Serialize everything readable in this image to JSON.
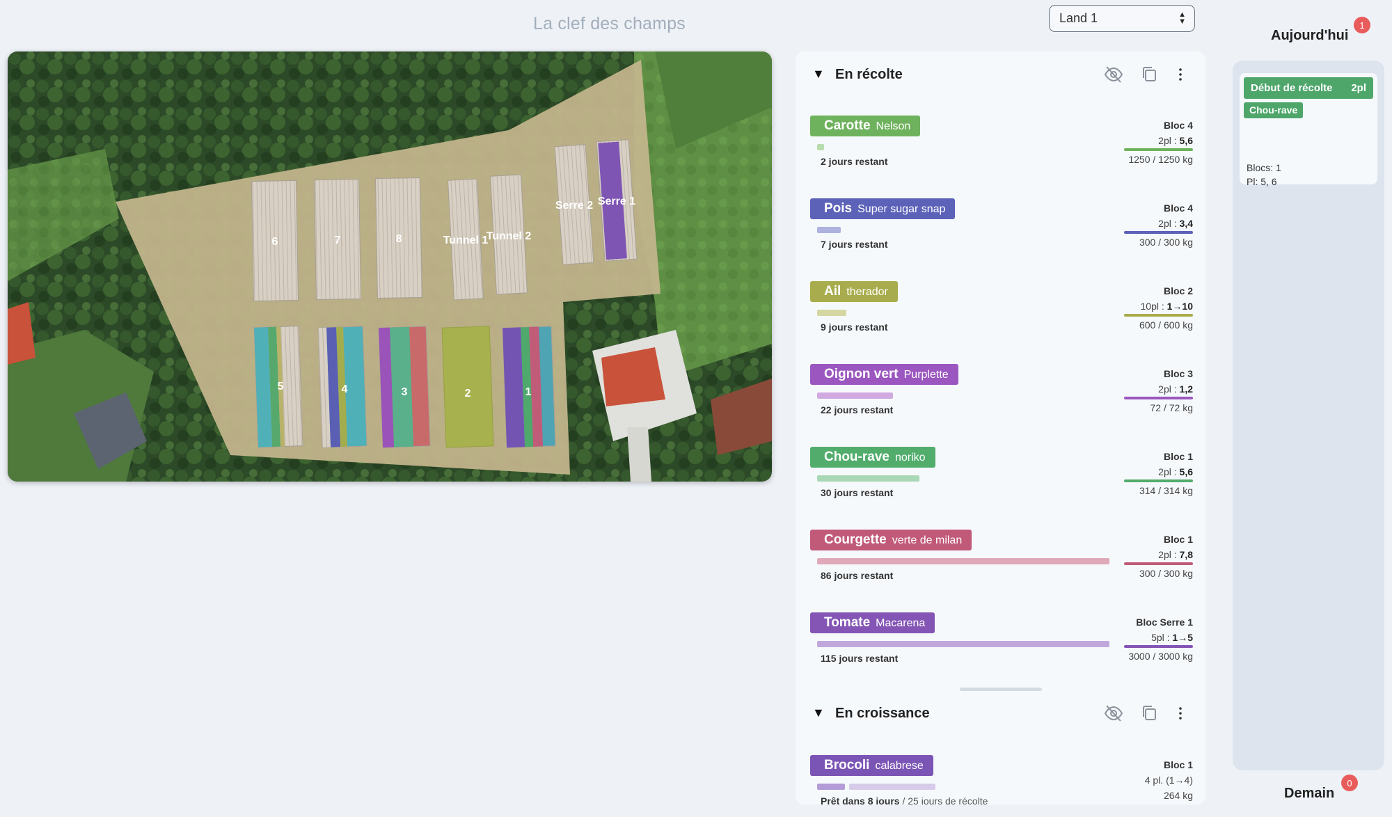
{
  "app": {
    "title": "La clef des champs"
  },
  "land_select": {
    "value": "Land 1"
  },
  "map": {
    "zone_labels": [
      "6",
      "7",
      "8",
      "Tunnel 1",
      "Tunnel 2",
      "Serre 2",
      "Serre 1",
      "5",
      "4",
      "3",
      "2",
      "1"
    ]
  },
  "sections": {
    "harvest": {
      "title": "En récolte",
      "icons": [
        "eye-off-icon",
        "copy-icon",
        "more-vertical-icon"
      ],
      "crops": [
        {
          "name": "Carotte",
          "variety": "Nelson",
          "color": "#6fb25d",
          "light": "#b9dcaf",
          "progress": 0.02,
          "remaining": "2 jours restant",
          "bloc": "Bloc 4",
          "pl_prefix": "2pl : ",
          "pl_value": "5,6",
          "kg": "1250 / 1250 kg"
        },
        {
          "name": "Pois",
          "variety": "Super sugar snap",
          "color": "#5b62b8",
          "light": "#aeb2df",
          "progress": 0.08,
          "remaining": "7 jours restant",
          "bloc": "Bloc 4",
          "pl_prefix": "2pl : ",
          "pl_value": "3,4",
          "kg": "300 / 300 kg"
        },
        {
          "name": "Ail",
          "variety": "therador",
          "color": "#a8ac4c",
          "light": "#d5d7a3",
          "progress": 0.1,
          "remaining": "9 jours restant",
          "bloc": "Bloc 2",
          "pl_prefix": "10pl : ",
          "pl_value": "1→10",
          "kg": "600 / 600 kg"
        },
        {
          "name": "Oignon vert",
          "variety": "Purplette",
          "color": "#9b57bf",
          "light": "#cfa9e0",
          "progress": 0.26,
          "remaining": "22 jours restant",
          "bloc": "Bloc 3",
          "pl_prefix": "2pl : ",
          "pl_value": "1,2",
          "kg": "72 / 72 kg"
        },
        {
          "name": "Chou-rave",
          "variety": "noriko",
          "color": "#52ad6d",
          "light": "#a9d8b6",
          "progress": 0.35,
          "remaining": "30 jours restant",
          "bloc": "Bloc 1",
          "pl_prefix": "2pl : ",
          "pl_value": "5,6",
          "kg": "314 / 314 kg"
        },
        {
          "name": "Courgette",
          "variety": "verte de milan",
          "color": "#c15978",
          "light": "#e0a9ba",
          "progress": 1.0,
          "remaining": "86 jours restant",
          "bloc": "Bloc 1",
          "pl_prefix": "2pl : ",
          "pl_value": "7,8",
          "kg": "300 / 300 kg"
        },
        {
          "name": "Tomate",
          "variety": "Macarena",
          "color": "#8455b5",
          "light": "#c1a8dc",
          "progress": 1.0,
          "remaining": "115 jours restant",
          "bloc": "Bloc Serre 1",
          "pl_prefix": "5pl : ",
          "pl_value": "1→5",
          "kg": "3000 / 3000 kg"
        }
      ]
    },
    "growing": {
      "title": "En croissance",
      "icons": [
        "eye-off-icon",
        "copy-icon",
        "more-vertical-icon"
      ],
      "crops": [
        {
          "name": "Brocoli",
          "variety": "calabrese",
          "color": "#7b55b5",
          "light": "#c3b0de",
          "remaining_bold": "Prêt dans 8 jours",
          "remaining_rest": " / 25 jours de récolte",
          "bloc": "Bloc 1",
          "pl_text": "4 pl. (1→4)",
          "kg": "264 kg"
        }
      ]
    }
  },
  "today": {
    "title": "Aujourd'hui",
    "count": "1",
    "event": {
      "title": "Début de récolte",
      "qty": "2pl",
      "crop": "Chou-rave",
      "blocs": "Blocs: 1",
      "pl": "Pl: 5, 6"
    }
  },
  "tomorrow": {
    "title": "Demain",
    "count": "0"
  }
}
